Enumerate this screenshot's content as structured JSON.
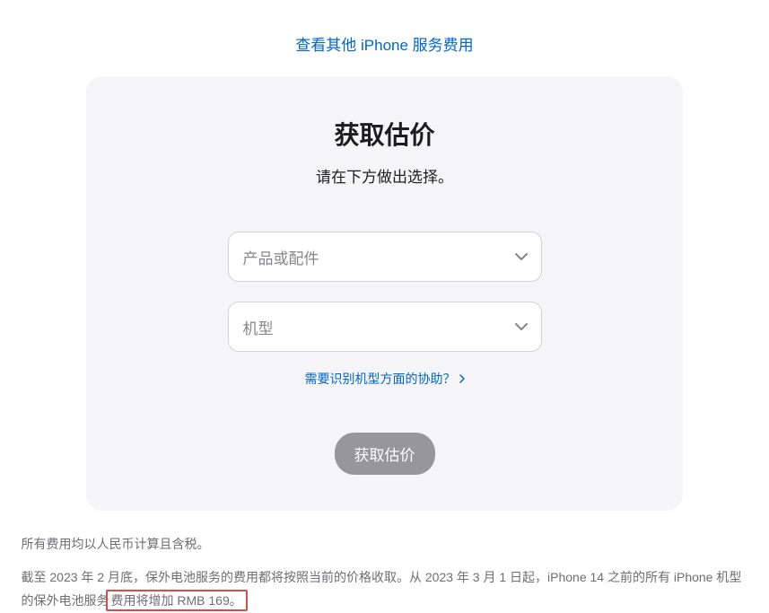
{
  "topLink": {
    "label": "查看其他 iPhone 服务费用"
  },
  "card": {
    "title": "获取估价",
    "subtitle": "请在下方做出选择。",
    "selectProduct": {
      "placeholder": "产品或配件"
    },
    "selectModel": {
      "placeholder": "机型"
    },
    "helpLink": {
      "label": "需要识别机型方面的协助？"
    },
    "submitButton": {
      "label": "获取估价"
    }
  },
  "footnotes": {
    "line1": "所有费用均以人民币计算且含税。",
    "line2_part1": "截至 2023 年 2 月底，保外电池服务的费用都将按照当前的价格收取。从 2023 年 3 月 1 日起，iPhone 14 之前的所有 iPhone 机型的保外电池服务",
    "line2_highlight": "费用将增加 RMB 169。"
  }
}
